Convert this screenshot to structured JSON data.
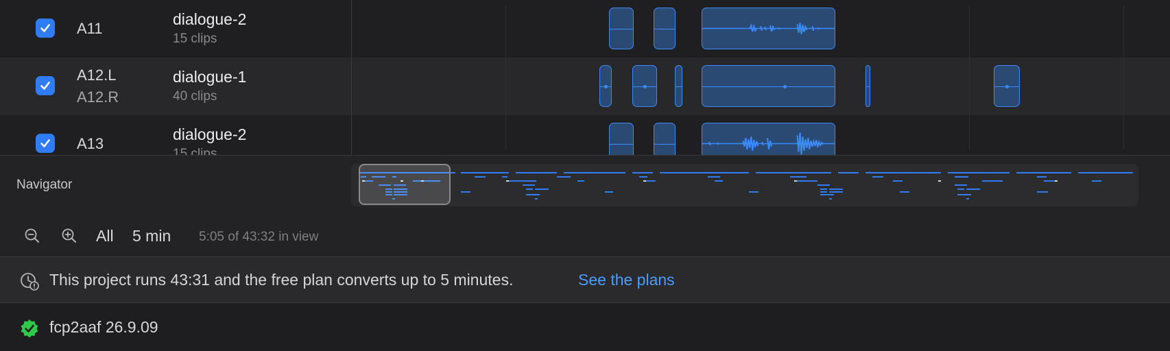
{
  "tracks": [
    {
      "id": "A11",
      "id2": "",
      "name": "dialogue-2",
      "clips": "15 clips",
      "checked": true
    },
    {
      "id": "A12.L",
      "id2": "A12.R",
      "name": "dialogue-1",
      "clips": "40 clips",
      "checked": true
    },
    {
      "id": "A13",
      "id2": "",
      "name": "dialogue-2",
      "clips": "15 clips",
      "checked": true
    }
  ],
  "navigator": {
    "label": "Navigator",
    "zoom_all": "All",
    "zoom_5min": "5 min",
    "in_view": "5:05 of 43:32 in view"
  },
  "banner": {
    "text": "This project runs 43:31 and the free plan converts up to 5 minutes.",
    "link": "See the plans"
  },
  "footer": {
    "version": "fcp2aaf 26.9.09",
    "badge_color": "#30c74a"
  },
  "colors": {
    "accent": "#2f7cf6",
    "clip_stroke": "#3a8bff",
    "link": "#4a9cff"
  },
  "icons": {
    "zoom_out": "zoom-out-icon",
    "zoom_in": "zoom-in-icon",
    "clock_alert": "clock-alert-icon",
    "verified": "verified-badge-icon",
    "check": "checkmark-icon"
  }
}
